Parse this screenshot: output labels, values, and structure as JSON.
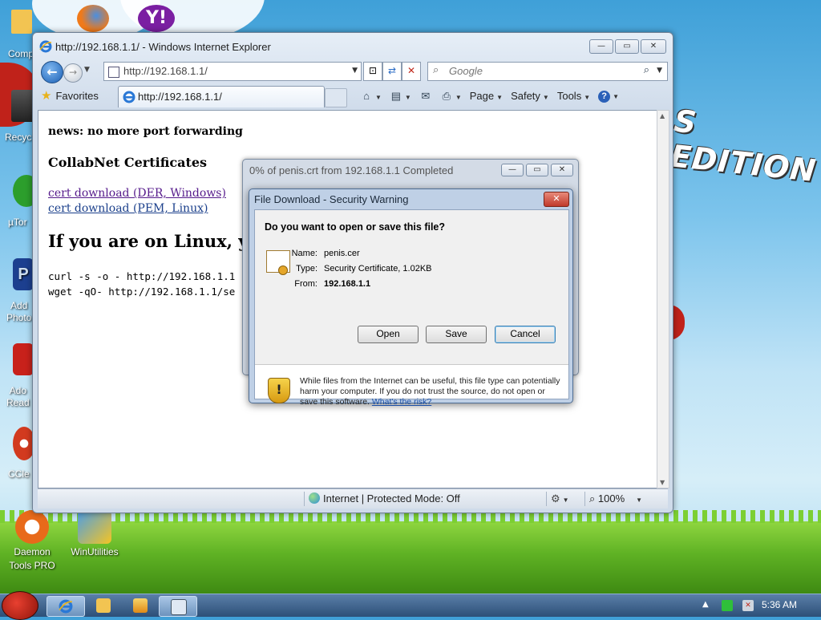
{
  "desktop": {
    "wallpaper_text": "S EDITION",
    "icons": [
      {
        "label": "Comp"
      },
      {
        "label": "Recyc"
      },
      {
        "label": "µTor"
      },
      {
        "label": "Add\nPhoto"
      },
      {
        "label": "Ado\nRead"
      },
      {
        "label": "CCle"
      },
      {
        "label": "Daemon\nTools PRO"
      },
      {
        "label": "WinUtilities"
      }
    ]
  },
  "ie": {
    "window_title": "http://192.168.1.1/ - Windows Internet Explorer",
    "address": "http://192.168.1.1/",
    "search_placeholder": "Google",
    "favorites_label": "Favorites",
    "tab_title": "http://192.168.1.1/",
    "commands": {
      "page": "Page",
      "safety": "Safety",
      "tools": "Tools"
    },
    "status": {
      "zone": "Internet | Protected Mode: Off",
      "zoom": "100%"
    }
  },
  "page": {
    "news": "news: no more port forwarding",
    "heading": "CollabNet Certificates",
    "link_der": "cert download (DER, Windows)",
    "link_pem": "cert download (PEM, Linux)",
    "linux_heading": "If you are on Linux, you",
    "code_curl": "curl -s -o - http://192.168.1.1",
    "code_wget": "wget -qO- http://192.168.1.1/se"
  },
  "download_dialog": {
    "title": "0% of penis.crt from 192.168.1.1 Completed"
  },
  "security_dialog": {
    "title": "File Download - Security Warning",
    "question": "Do you want to open or save this file?",
    "name_label": "Name:",
    "name_value": "penis.cer",
    "type_label": "Type:",
    "type_value": "Security Certificate, 1.02KB",
    "from_label": "From:",
    "from_value": "192.168.1.1",
    "open_label": "Open",
    "save_label": "Save",
    "cancel_label": "Cancel",
    "warning_text": "While files from the Internet can be useful, this file type can potentially harm your computer. If you do not trust the source, do not open or save this software.",
    "risk_link": "What's the risk?"
  },
  "taskbar": {
    "clock": "5:36 AM"
  }
}
